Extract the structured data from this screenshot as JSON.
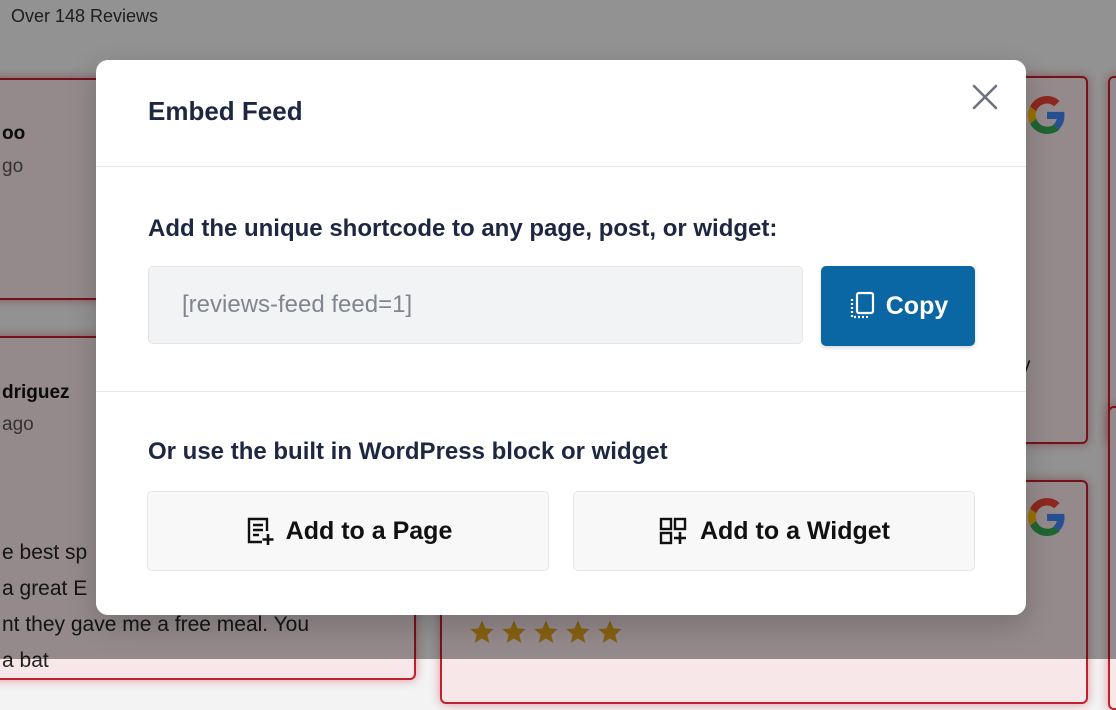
{
  "background": {
    "reviews_count": "Over 148 Reviews",
    "cards": [
      {
        "name": "oo",
        "ago": "go"
      },
      {
        "name": "driguez",
        "ago": "ago",
        "text_lines": [
          "e best sp",
          " a great E",
          "nt they gave me a free meal. You",
          " a bat"
        ]
      },
      {
        "right_fragment": "y"
      },
      {
        "rating": 5
      }
    ]
  },
  "modal": {
    "title": "Embed Feed",
    "close_icon": "close-icon",
    "shortcode_section": {
      "label": "Add the unique shortcode to any page, post, or widget:",
      "shortcode_value": "[reviews-feed feed=1]",
      "copy_label": "Copy",
      "copy_icon": "copy-icon"
    },
    "block_section": {
      "label": "Or use the built in WordPress block or widget",
      "add_page_label": "Add to a Page",
      "add_page_icon": "page-add-icon",
      "add_widget_label": "Add to a Widget",
      "add_widget_icon": "widget-add-icon"
    }
  },
  "colors": {
    "primary": "#0a67a3",
    "title_text": "#1d2742",
    "card_border": "#c2202f",
    "star": "#e0a21f"
  }
}
